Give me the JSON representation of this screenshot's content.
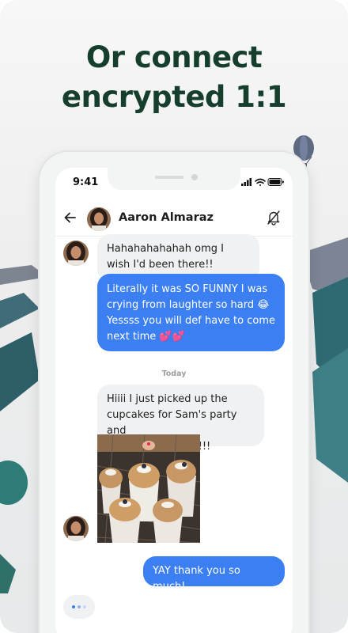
{
  "headline": {
    "line1": "Or connect",
    "line2": "encrypted 1:1"
  },
  "status_bar": {
    "time": "9:41"
  },
  "chat_header": {
    "contact_name": "Aaron Almaraz"
  },
  "messages": [
    {
      "direction": "incoming",
      "text": "Hahahahahahah omg I wish I'd been there!!"
    },
    {
      "direction": "outgoing",
      "line1": "Literally it was SO FUNNY I was",
      "line2": "crying from laughter so hard 😂",
      "line3": "Yessss you will def have to come",
      "line4": "next time 💕💕"
    },
    {
      "direction": "incoming",
      "line1": "Hiiii I just picked up the",
      "line2": "cupcakes for Sam's party and",
      "line3": "they look so good!!!"
    },
    {
      "direction": "outgoing",
      "text": "YAY thank you so much!"
    }
  ],
  "day_separator": "Today",
  "icons": {
    "back": "arrow-left-icon",
    "mute": "bell-muted-icon",
    "signal": "signal-icon",
    "wifi": "wifi-icon",
    "battery": "battery-icon"
  },
  "colors": {
    "headline": "#153f2c",
    "outgoing_bubble": "#3b7ff3",
    "incoming_bubble": "#f0f1f2"
  }
}
